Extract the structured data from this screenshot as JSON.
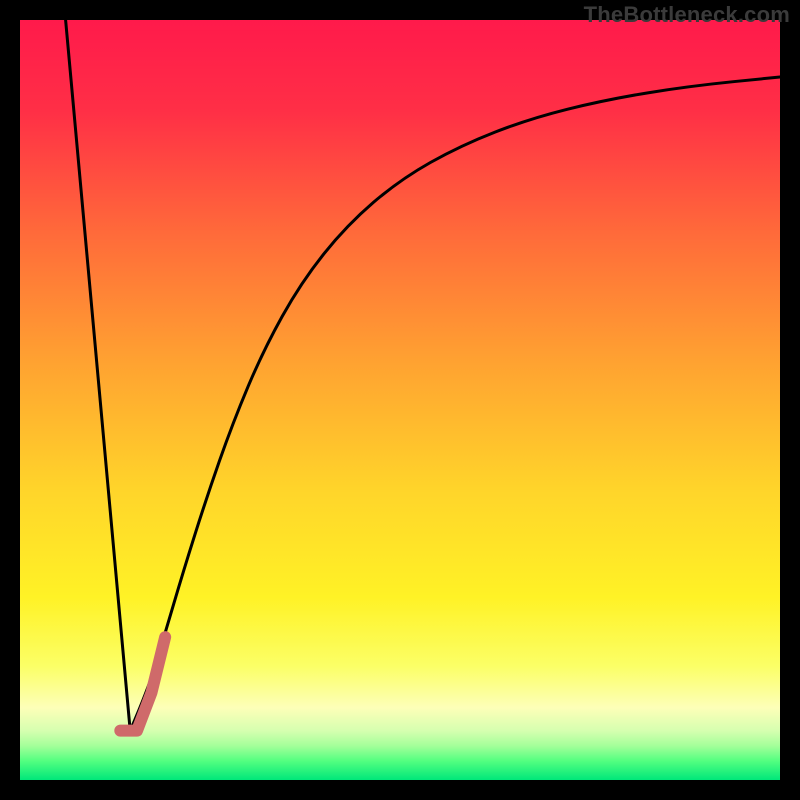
{
  "watermark": "TheBottleneck.com",
  "colors": {
    "frame": "#000000",
    "curve_black": "#000000",
    "curve_red": "#cf6a6a",
    "gradient_stops": [
      {
        "offset": 0.0,
        "color": "#ff1a4b"
      },
      {
        "offset": 0.12,
        "color": "#ff2f46"
      },
      {
        "offset": 0.28,
        "color": "#ff6a3a"
      },
      {
        "offset": 0.45,
        "color": "#ffa231"
      },
      {
        "offset": 0.62,
        "color": "#ffd52a"
      },
      {
        "offset": 0.76,
        "color": "#fff226"
      },
      {
        "offset": 0.85,
        "color": "#fbff66"
      },
      {
        "offset": 0.905,
        "color": "#fdffb8"
      },
      {
        "offset": 0.935,
        "color": "#d6ffb0"
      },
      {
        "offset": 0.955,
        "color": "#a4ff9a"
      },
      {
        "offset": 0.975,
        "color": "#53ff80"
      },
      {
        "offset": 1.0,
        "color": "#00e77a"
      }
    ]
  },
  "chart_data": {
    "type": "line",
    "title": "",
    "xlabel": "",
    "ylabel": "",
    "xlim": [
      0,
      100
    ],
    "ylim": [
      0,
      100
    ],
    "series": [
      {
        "name": "left-descent",
        "values_xy": [
          [
            6,
            100
          ],
          [
            14.5,
            6.5
          ]
        ]
      },
      {
        "name": "right-curve",
        "values_xy": [
          [
            14.5,
            6.5
          ],
          [
            16.9,
            12.0
          ],
          [
            19.0,
            19.0
          ],
          [
            21.5,
            27.5
          ],
          [
            24.5,
            37.0
          ],
          [
            28.0,
            47.0
          ],
          [
            32.0,
            56.5
          ],
          [
            37.0,
            65.5
          ],
          [
            43.0,
            73.0
          ],
          [
            50.0,
            79.0
          ],
          [
            58.0,
            83.5
          ],
          [
            67.0,
            87.0
          ],
          [
            77.0,
            89.5
          ],
          [
            88.0,
            91.3
          ],
          [
            100.0,
            92.5
          ]
        ]
      },
      {
        "name": "short-red-overlay",
        "values_xy": [
          [
            13.2,
            6.5
          ],
          [
            15.4,
            6.5
          ],
          [
            17.3,
            11.5
          ],
          [
            19.1,
            18.8
          ]
        ]
      }
    ]
  }
}
